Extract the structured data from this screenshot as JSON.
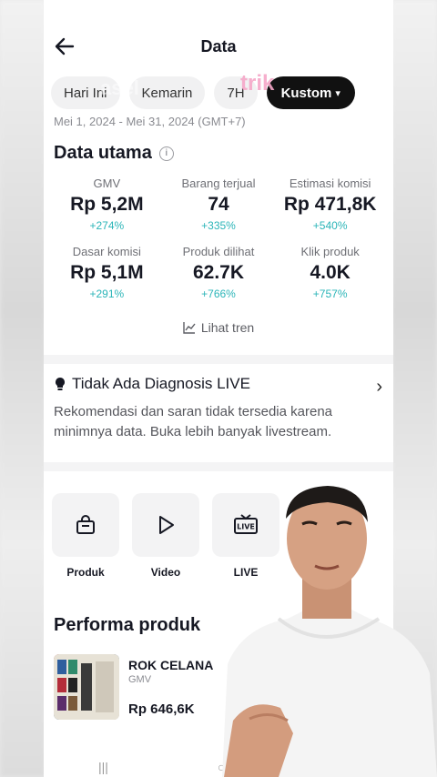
{
  "header": {
    "title": "Data"
  },
  "chips": [
    {
      "label": "Hari Ini",
      "active": false
    },
    {
      "label": "Kemarin",
      "active": false
    },
    {
      "label": "7H",
      "active": false
    },
    {
      "label": "Kustom",
      "active": true
    }
  ],
  "date_range": "Mei 1, 2024 - Mei 31, 2024 (GMT+7)",
  "main_data": {
    "title": "Data utama",
    "metrics": [
      {
        "label": "GMV",
        "value": "Rp 5,2M",
        "change": "+274%"
      },
      {
        "label": "Barang terjual",
        "value": "74",
        "change": "+335%"
      },
      {
        "label": "Estimasi komisi",
        "value": "Rp 471,8K",
        "change": "+540%"
      },
      {
        "label": "Dasar komisi",
        "value": "Rp 5,1M",
        "change": "+291%"
      },
      {
        "label": "Produk dilihat",
        "value": "62.7K",
        "change": "+766%"
      },
      {
        "label": "Klik produk",
        "value": "4.0K",
        "change": "+757%"
      }
    ],
    "trend_link": "Lihat tren"
  },
  "diagnosis": {
    "title": "Tidak Ada Diagnosis LIVE",
    "body": "Rekomendasi dan saran tidak tersedia karena minimnya data. Buka lebih banyak livestream."
  },
  "shortcuts": [
    {
      "label": "Produk",
      "icon": "shopping-bag-icon"
    },
    {
      "label": "Video",
      "icon": "play-icon"
    },
    {
      "label": "LIVE",
      "icon": "live-tv-icon"
    }
  ],
  "performance": {
    "title": "Performa produk",
    "product": {
      "name": "ROK CELANA",
      "metric_label": "GMV",
      "value": "Rp 646,6K"
    }
  },
  "overlay": {
    "text": "trik",
    "faded_text": "asel"
  },
  "colors": {
    "positive": "#2bb5b8",
    "active_chip": "#111111",
    "overlay_pink": "#f6a7c8"
  }
}
